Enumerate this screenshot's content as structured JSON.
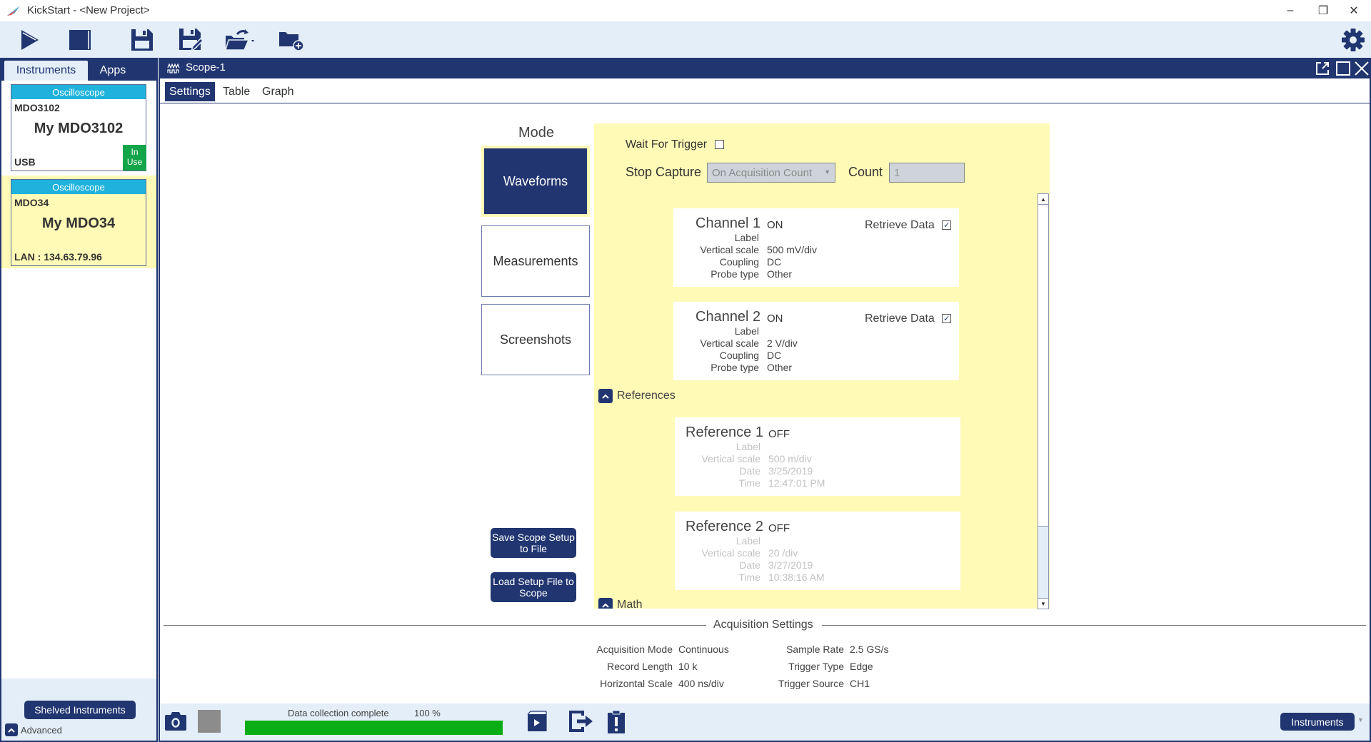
{
  "window": {
    "title": "KickStart - <New Project>",
    "controls": {
      "minimize": "–",
      "restore": "❐",
      "close": "✕"
    }
  },
  "toolbar": {
    "buttons": [
      {
        "name": "run",
        "icon": "play-icon"
      },
      {
        "name": "stop",
        "icon": "stop-icon"
      },
      {
        "name": "save",
        "icon": "save-icon"
      },
      {
        "name": "save-as",
        "icon": "save-as-icon"
      },
      {
        "name": "open",
        "icon": "open-folder-icon"
      },
      {
        "name": "new-project",
        "icon": "new-folder-icon"
      }
    ],
    "settings_icon": "gear-icon"
  },
  "left_panel": {
    "tabs": [
      {
        "label": "Instruments",
        "active": true
      },
      {
        "label": "Apps",
        "active": false
      }
    ],
    "instruments": [
      {
        "type": "Oscilloscope",
        "model": "MDO3102",
        "nickname": "My MDO3102",
        "connection": "USB",
        "badge": "In Use",
        "selected": false
      },
      {
        "type": "Oscilloscope",
        "model": "MDO34",
        "nickname": "My MDO34",
        "connection": "LAN : 134.63.79.96",
        "badge": "",
        "selected": true
      }
    ],
    "shelved_button": "Shelved Instruments",
    "advanced_label": "Advanced"
  },
  "scope": {
    "title": "Scope-1",
    "tabs": [
      {
        "label": "Settings",
        "active": true
      },
      {
        "label": "Table",
        "active": false
      },
      {
        "label": "Graph",
        "active": false
      }
    ],
    "mode": {
      "label": "Mode",
      "buttons": [
        {
          "label": "Waveforms",
          "active": true
        },
        {
          "label": "Measurements",
          "active": false
        },
        {
          "label": "Screenshots",
          "active": false
        }
      ]
    },
    "wait_for_trigger": {
      "label": "Wait For Trigger",
      "checked": false
    },
    "stop_capture": {
      "label": "Stop Capture",
      "value": "On Acquisition Count"
    },
    "count": {
      "label": "Count",
      "value": "1"
    },
    "channels": [
      {
        "name": "Channel 1",
        "state": "ON",
        "retrieve_label": "Retrieve Data",
        "retrieve_checked": true,
        "rows": [
          {
            "label": "Label",
            "value": ""
          },
          {
            "label": "Vertical scale",
            "value": "500 mV/div"
          },
          {
            "label": "Coupling",
            "value": "DC"
          },
          {
            "label": "Probe type",
            "value": "Other"
          }
        ]
      },
      {
        "name": "Channel 2",
        "state": "ON",
        "retrieve_label": "Retrieve Data",
        "retrieve_checked": true,
        "rows": [
          {
            "label": "Label",
            "value": ""
          },
          {
            "label": "Vertical scale",
            "value": "2 V/div"
          },
          {
            "label": "Coupling",
            "value": "DC"
          },
          {
            "label": "Probe type",
            "value": "Other"
          }
        ]
      }
    ],
    "references_section": "References",
    "references": [
      {
        "name": "Reference 1",
        "state": "OFF",
        "rows": [
          {
            "label": "Label",
            "value": ""
          },
          {
            "label": "Vertical scale",
            "value": "500 m/div"
          },
          {
            "label": "Date",
            "value": "3/25/2019"
          },
          {
            "label": "Time",
            "value": "12:47:01 PM"
          }
        ]
      },
      {
        "name": "Reference 2",
        "state": "OFF",
        "rows": [
          {
            "label": "Label",
            "value": ""
          },
          {
            "label": "Vertical scale",
            "value": "20 /div"
          },
          {
            "label": "Date",
            "value": "3/27/2019"
          },
          {
            "label": "Time",
            "value": "10:38:16 AM"
          }
        ]
      }
    ],
    "math_section": "Math",
    "save_setup_button": "Save Scope Setup to File",
    "load_setup_button": "Load Setup File to Scope",
    "acquisition": {
      "title": "Acquisition Settings",
      "left": [
        {
          "label": "Acquisition Mode",
          "value": "Continuous"
        },
        {
          "label": "Record Length",
          "value": "10 k"
        },
        {
          "label": "Horizontal Scale",
          "value": "400 ns/div"
        }
      ],
      "right": [
        {
          "label": "Sample Rate",
          "value": "2.5 GS/s"
        },
        {
          "label": "Trigger Type",
          "value": "Edge"
        },
        {
          "label": "Trigger Source",
          "value": "CH1"
        }
      ]
    }
  },
  "status": {
    "progress_label": "Data collection complete",
    "progress_text": "100 %",
    "progress_fraction": 1.0,
    "progress_color": "#0aad13",
    "instruments_button": "Instruments"
  },
  "colors": {
    "navy": "#213671",
    "yellow": "#fffab6",
    "cyan": "#1eb2dc",
    "in_use_green": "#13a54a",
    "light_blue": "#e4eef8"
  }
}
